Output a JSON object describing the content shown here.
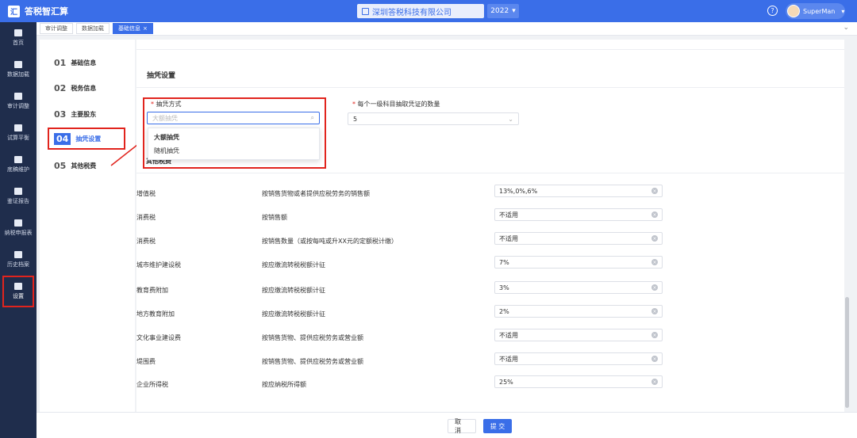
{
  "app": {
    "title": "答税智汇算",
    "logo_text": "汇"
  },
  "header": {
    "company": "深圳答税科技有限公司",
    "year": "2022",
    "help_label": "?",
    "user_name": "SuperMan"
  },
  "sidebar": {
    "items": [
      {
        "label": "首页",
        "icon": "home-icon"
      },
      {
        "label": "数据加载",
        "icon": "database-icon"
      },
      {
        "label": "审计调整",
        "icon": "audit-icon"
      },
      {
        "label": "试算平衡",
        "icon": "balance-icon"
      },
      {
        "label": "底稿维护",
        "icon": "document-icon"
      },
      {
        "label": "鉴证报告",
        "icon": "check-icon"
      },
      {
        "label": "纳税申报表",
        "icon": "monitor-icon"
      },
      {
        "label": "历史档案",
        "icon": "folder-icon"
      },
      {
        "label": "设置",
        "icon": "gear-icon"
      }
    ]
  },
  "tabs": [
    {
      "label": "审计调整"
    },
    {
      "label": "数据加载"
    },
    {
      "label": "基础信息",
      "close": "×"
    }
  ],
  "steps": [
    {
      "num": "01",
      "label": "基础信息"
    },
    {
      "num": "02",
      "label": "税务信息"
    },
    {
      "num": "03",
      "label": "主要股东"
    },
    {
      "num": "04",
      "label": "抽凭设置"
    },
    {
      "num": "05",
      "label": "其他税费"
    }
  ],
  "section": {
    "title": "抽凭设置",
    "method_label": "抽凭方式",
    "method_placeholder": "大额抽凭",
    "method_options": [
      "大额抽凭",
      "随机抽凭"
    ],
    "count_label": "每个一级科目抽取凭证的数量",
    "count_value": "5",
    "partial_title": "其他税费"
  },
  "taxes": [
    {
      "name": "增值税",
      "basis": "按销售货物或者提供应税劳务的销售额",
      "value": "13%,0%,6%"
    },
    {
      "name": "消费税",
      "basis": "按销售额",
      "value": "不适用"
    },
    {
      "name": "消费税",
      "basis": "按销售数量（或按每吨或升XX元的定额税计缴）",
      "value": "不适用"
    },
    {
      "name": "城市维护建设税",
      "basis": "按应缴流转税税额计征",
      "value": "7%"
    },
    {
      "name": "教育费附加",
      "basis": "按应缴流转税税额计征",
      "value": "3%"
    },
    {
      "name": "地方教育附加",
      "basis": "按应缴流转税税额计征",
      "value": "2%"
    },
    {
      "name": "文化事业建设费",
      "basis": "按销售货物、提供应税劳务或营业额",
      "value": "不适用"
    },
    {
      "name": "堤围费",
      "basis": "按销售货物、提供应税劳务或营业额",
      "value": "不适用"
    },
    {
      "name": "企业所得税",
      "basis": "按应纳税所得额",
      "value": "25%"
    }
  ],
  "footer": {
    "cancel_label": "取 消",
    "submit_label": "提 交"
  },
  "colors": {
    "primary": "#3a6ee8",
    "sidebar": "#1f2d4c",
    "annotation": "#e1241d"
  }
}
